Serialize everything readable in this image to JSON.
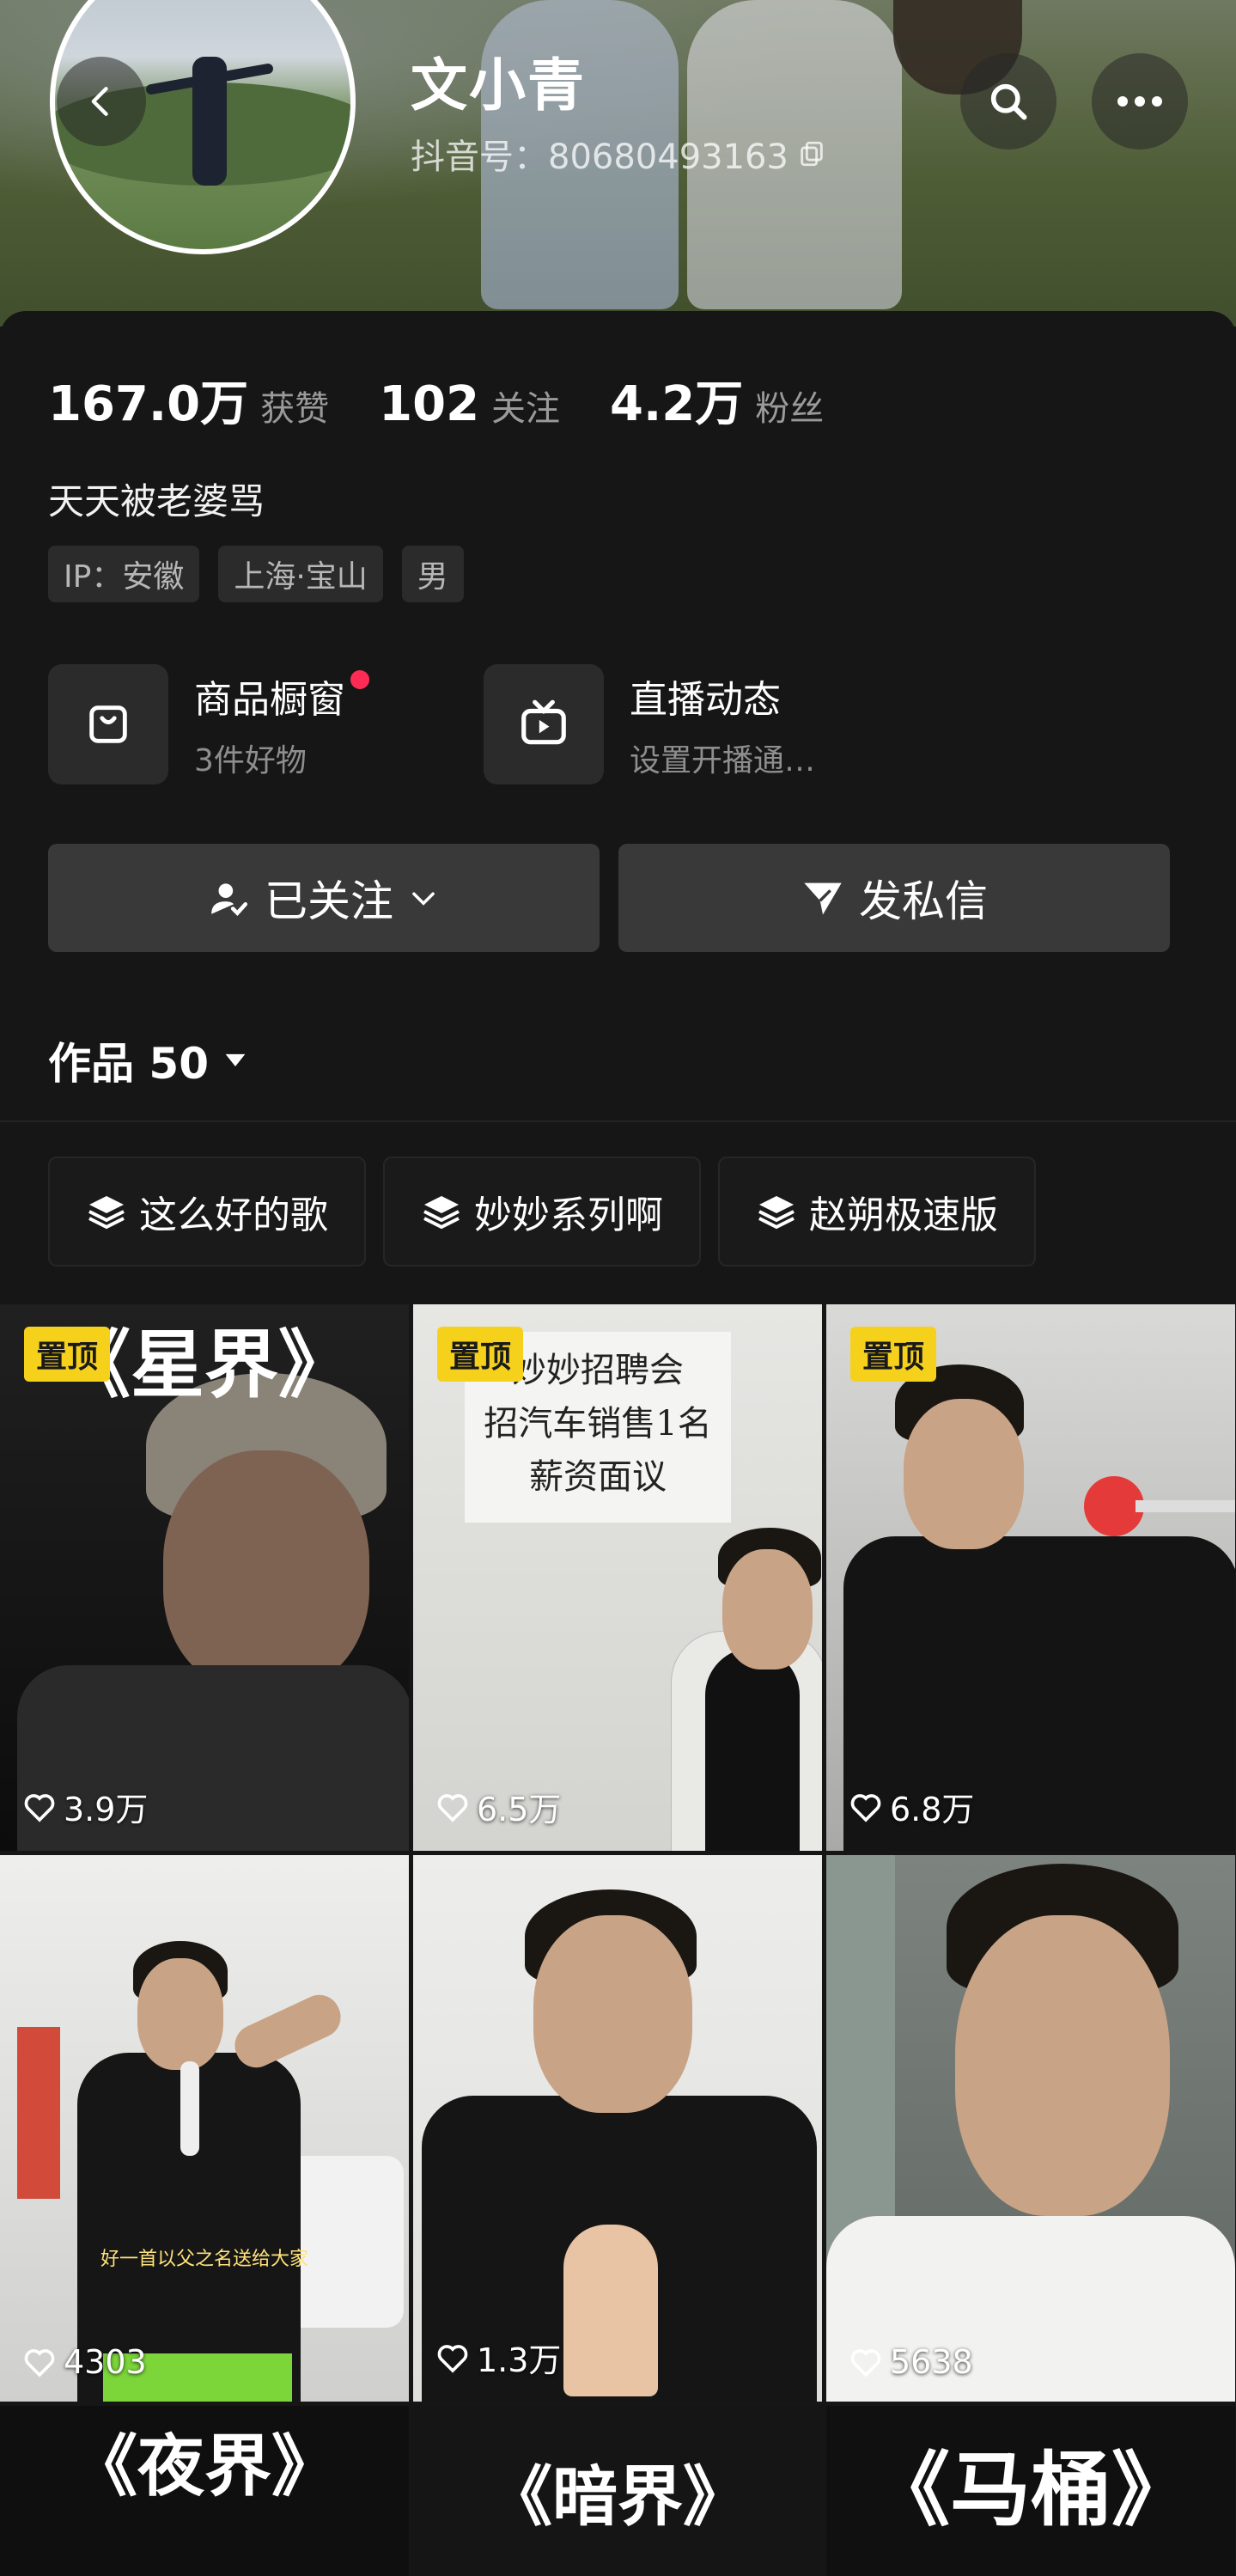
{
  "profile": {
    "name": "文小青",
    "douyin_id": "抖音号：80680493163",
    "bio": "天天被老婆骂"
  },
  "stats": [
    {
      "value": "167.0万",
      "label": "获赞"
    },
    {
      "value": "102",
      "label": "关注"
    },
    {
      "value": "4.2万",
      "label": "粉丝"
    }
  ],
  "tags": [
    "IP：安徽",
    "上海·宝山",
    "男"
  ],
  "features": {
    "shop": {
      "title": "商品橱窗",
      "subtitle": "3件好物"
    },
    "live": {
      "title": "直播动态",
      "subtitle": "设置开播通…"
    }
  },
  "buttons": {
    "follow": "已关注",
    "message": "发私信"
  },
  "works": {
    "label": "作品 50"
  },
  "collections": [
    "这么好的歌",
    "妙妙系列啊",
    "赵朔极速版"
  ],
  "videos": [
    {
      "pinned": "置顶",
      "likes": "3.9万",
      "title": "《星界》"
    },
    {
      "pinned": "置顶",
      "likes": "6.5万",
      "sign": "妙妙招聘会\n招汽车销售1名\n薪资面议"
    },
    {
      "pinned": "置顶",
      "likes": "6.8万"
    },
    {
      "likes": "4303",
      "caption": "好一首以父之名送给大家"
    },
    {
      "likes": "1.3万"
    },
    {
      "likes": "5638"
    },
    {
      "title": "《夜界》"
    },
    {
      "title": "《暗界》"
    },
    {
      "title": "《马桶》"
    }
  ],
  "colors": {
    "background": "#161616",
    "button": "#393939",
    "pin_badge": "#f6d11c",
    "notification_dot": "#fe2c55"
  },
  "icons": [
    "back-icon",
    "search-icon",
    "more-icon",
    "copy-icon",
    "shopping-bag-icon",
    "tv-icon",
    "user-check-icon",
    "chevron-down-icon",
    "send-icon",
    "caret-down-icon",
    "layers-icon",
    "heart-icon"
  ]
}
